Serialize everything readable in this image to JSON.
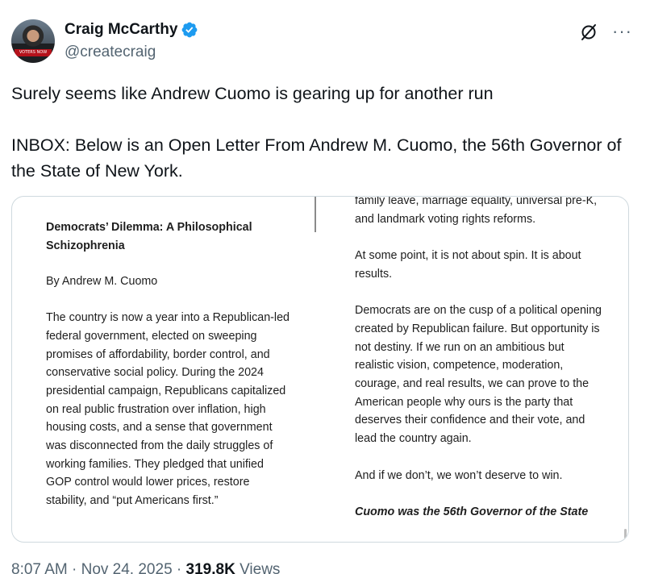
{
  "author": {
    "name": "Craig McCarthy",
    "handle": "@createcraig",
    "avatar_banner_text": "VOTERS NOW"
  },
  "tweet": {
    "line1": "Surely seems like Andrew Cuomo is gearing up for another run",
    "line2": "INBOX: Below is an Open Letter From Andrew M. Cuomo, the 56th Governor of the State of New York."
  },
  "letter": {
    "heading": "Democrats’ Dilemma: A Philosophical Schizophrenia",
    "byline": "By Andrew M. Cuomo",
    "left_body": "The country is now a year into a Republican-led federal government, elected on sweeping promises of affordability, border control, and conservative social policy. During the 2024 presidential campaign, Republicans capitalized on real public frustration over inflation, high housing costs, and a sense that government was disconnected from the daily struggles of working families. They pledged that unified GOP control would lower prices, restore stability, and “put Americans first.”",
    "right_p1": "family leave, marriage equality, universal pre-K, and landmark voting rights reforms.",
    "right_p2": "At some point, it is not about spin. It is about results.",
    "right_p3": "Democrats are on the cusp of a political opening created by Republican failure. But opportunity is not destiny. If we run on an ambitious but realistic vision, competence, moderation, courage, and real results, we can prove to the American people why ours is the party that deserves their confidence and their vote, and lead the country again.",
    "right_p4": "And if we don’t, we won’t deserve to win.",
    "right_credit": "Cuomo was the 56th Governor of the State"
  },
  "meta": {
    "time": "8:07 AM",
    "sep1": "·",
    "date": "Nov 24, 2025",
    "sep2": "·",
    "views_count": "319.8K",
    "views_label": "Views"
  },
  "colors": {
    "verified": "#1d9bf0",
    "secondary_text": "#536471",
    "primary_text": "#0f1419",
    "border": "#cfd9de"
  },
  "icons": {
    "verified": "verified-badge-icon",
    "grok": "grok-icon",
    "more": "more-icon"
  }
}
